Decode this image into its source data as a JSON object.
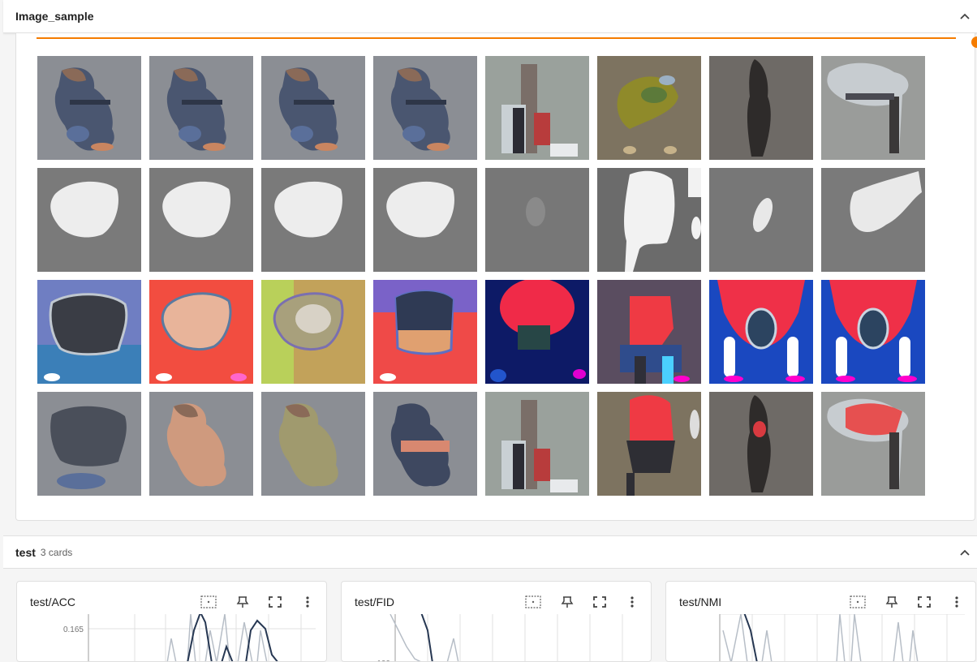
{
  "image_section": {
    "title": "Image_sample",
    "slider_value": 1.0,
    "accent": "#f57c00",
    "tile_descriptions": [
      [
        "colored-blob",
        "colored-blob",
        "colored-blob",
        "colored-blob",
        "tower-figure",
        "green-landscape",
        "dark-figure",
        "grey-figure"
      ],
      [
        "white-mask",
        "white-mask",
        "white-mask",
        "white-mask",
        "faint-mask",
        "white-mask-split",
        "small-mask",
        "white-mask-right"
      ],
      [
        "dark-shape-colorful",
        "peach-shape-red",
        "olive-shape",
        "navy-shape-red",
        "red-blue-abstract",
        "noisy-red-abstract",
        "red-blue-white",
        "red-blue-white"
      ],
      [
        "dark-blob",
        "peach-blob",
        "olive-blob",
        "navy-blob",
        "tower-figure",
        "red-dark-figure",
        "dark-red-figure",
        "grey-red-figure"
      ]
    ]
  },
  "test_section": {
    "title": "test",
    "count_label": "3 cards"
  },
  "cards": [
    {
      "title": "test/ACC",
      "ytick": "0.165",
      "icons": [
        "fit-domain-icon",
        "pin-icon",
        "fullscreen-icon",
        "more-icon"
      ]
    },
    {
      "title": "test/FID",
      "ytick": "100",
      "icons": [
        "fit-domain-icon",
        "pin-icon",
        "fullscreen-icon",
        "more-icon"
      ]
    },
    {
      "title": "test/NMI",
      "ytick": "",
      "icons": [
        "fit-domain-icon",
        "pin-icon",
        "fullscreen-icon",
        "more-icon"
      ]
    }
  ]
}
